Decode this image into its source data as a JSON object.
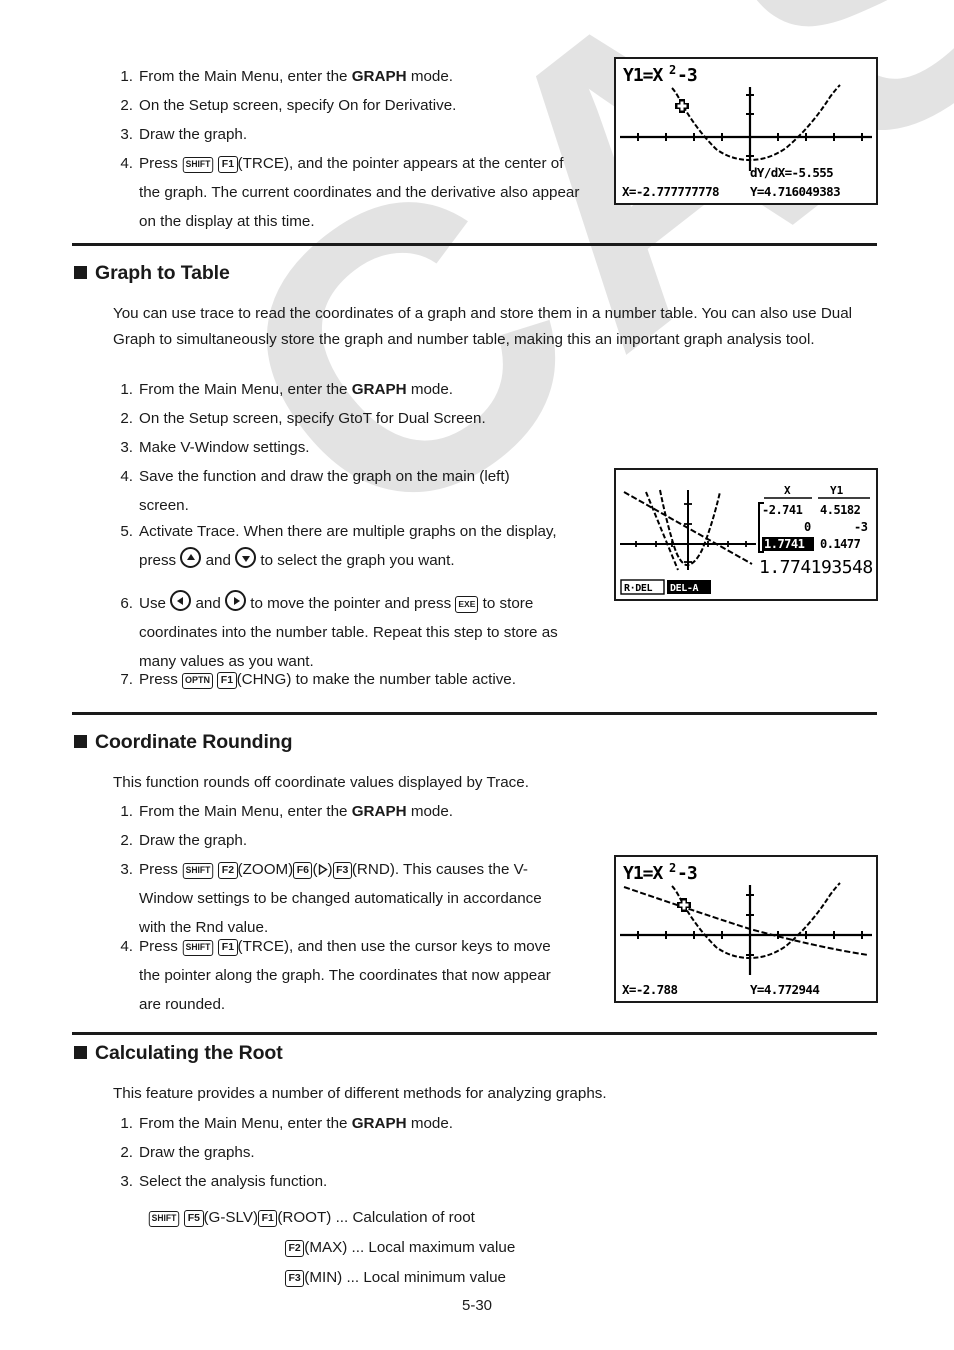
{
  "page": {
    "footer": "5-30"
  },
  "intro_steps": [
    {
      "num": "1.",
      "pre": "From the Main Menu, enter the ",
      "bold": "GRAPH",
      "post": " mode."
    },
    {
      "num": "2.",
      "text": "On the Setup screen, specify On for Derivative."
    },
    {
      "num": "3.",
      "text": "Draw the graph."
    },
    {
      "num": "4.",
      "pre": "Press ",
      "keys": [
        "SHIFT",
        "F1"
      ],
      "post": "(TRCE), and the pointer appears at the center of the graph. The current coordinates and the derivative also appear on the display at this time."
    }
  ],
  "sections": [
    {
      "heading": "Graph to Table",
      "paragraph": "You can use trace to read the coordinates of a graph and store them in a number table. You can also use Dual Graph to simultaneously store the graph and number table, making this an important graph analysis tool.",
      "steps": [
        {
          "num": "1.",
          "pre": "From the Main Menu, enter the ",
          "bold": "GRAPH",
          "post": " mode."
        },
        {
          "num": "2.",
          "text": "On the Setup screen, specify GtoT for Dual Screen."
        },
        {
          "num": "3.",
          "text": "Make V-Window settings."
        },
        {
          "num": "4.",
          "text": "Save the function and draw the graph on the main (left) screen."
        },
        {
          "num": "5.",
          "pre": "Activate Trace.  When there are multiple graphs on the display, press ",
          "mid": " and ",
          "post": " to select the graph you want."
        },
        {
          "num": "6.",
          "pre": "Use ",
          "mid": " and ",
          "mid2": " to move the pointer and press ",
          "post": " to store coordinates into the number table. Repeat this step to store as many values as you want."
        },
        {
          "num": "7.",
          "pre": "Press ",
          "keys": [
            "OPTN",
            "F1"
          ],
          "post": "(CHNG) to make the number table active."
        }
      ]
    },
    {
      "heading": "Coordinate Rounding",
      "paragraph": "This function rounds off coordinate values displayed by Trace.",
      "steps": [
        {
          "num": "1.",
          "pre": "From the Main Menu, enter the ",
          "bold": "GRAPH",
          "post": " mode."
        },
        {
          "num": "2.",
          "text": "Draw the graph."
        },
        {
          "num": "3.",
          "pre": "Press ",
          "k1": "SHIFT",
          "k2": "F2",
          "t1": "(ZOOM)",
          "k3": "F6",
          "t2": "(",
          "t3": ")",
          "k4": "F3",
          "post": "(RND). This causes the V-Window settings to be changed automatically in accordance with the Rnd value."
        },
        {
          "num": "4.",
          "pre": "Press ",
          "keys": [
            "SHIFT",
            "F1"
          ],
          "post": "(TRCE), and then use the cursor keys to move the pointer along the graph. The coordinates that now appear are rounded."
        }
      ]
    },
    {
      "heading": "Calculating the Root",
      "paragraph": "This feature provides a number of different methods for analyzing graphs.",
      "steps": [
        {
          "num": "1.",
          "pre": "From the Main Menu, enter the ",
          "bold": "GRAPH",
          "post": " mode."
        },
        {
          "num": "2.",
          "text": "Draw the graphs."
        },
        {
          "num": "3.",
          "text": "Select the analysis function."
        }
      ],
      "key_sequences": [
        {
          "keys": [
            "SHIFT",
            "F5"
          ],
          "label": "(G-SLV)",
          "key2": "F1",
          "label2": "(ROOT)",
          "desc": " ... Calculation of root"
        },
        {
          "key2": "F2",
          "label2": "(MAX)",
          "desc": " ... Local maximum value"
        },
        {
          "key2": "F3",
          "label2": "(MIN)",
          "desc": " ... Local minimum value"
        }
      ]
    }
  ],
  "screens": {
    "trace_derivative": {
      "function_label": "Y1=X2-3",
      "deriv_label": "dY/dX=-5.555",
      "x_label": "X=-2.777777778",
      "y_label": "Y=4.716049383"
    },
    "graph_to_table": {
      "col_x": "X",
      "col_y1": "Y1",
      "rows": [
        {
          "x": "-2.741",
          "y": "4.5182",
          "selected": false
        },
        {
          "x": "0",
          "y": "-3",
          "selected": false
        },
        {
          "x": "1.7741",
          "y": "0.1477",
          "selected": true
        }
      ],
      "edit_value": "1.774193548",
      "softkey_1": "R·DEL",
      "softkey_2": "DEL-A"
    },
    "coordinate_rounding": {
      "function_label": "Y1=X2-3",
      "x_label": "X=-2.788",
      "y_label": "Y=4.772944"
    }
  },
  "watermark": {
    "text": "CASIO",
    "color": "#e3e3e3"
  }
}
